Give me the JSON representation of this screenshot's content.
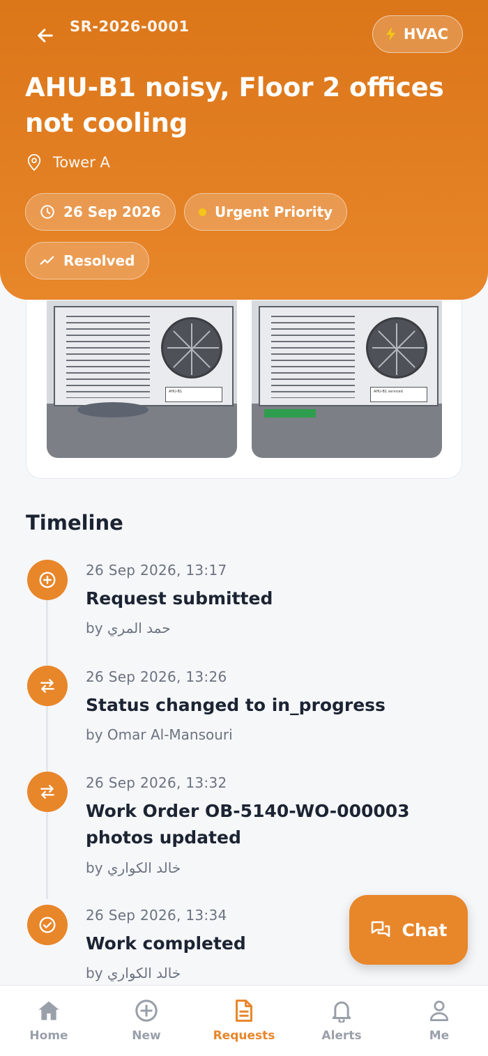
{
  "header": {
    "reference": "SR-2026-0001",
    "category": "HVAC",
    "title": "AHU-B1 noisy, Floor 2 offices not cooling",
    "location": "Tower A",
    "date": "26 Sep 2026",
    "priority": "Urgent Priority",
    "status": "Resolved"
  },
  "photos": {
    "before_label": "AHU-B1",
    "after_label": "AHU-B1 serviced"
  },
  "timeline": {
    "title": "Timeline",
    "events": [
      {
        "time": "26 Sep 2026, 13:17",
        "heading": "Request submitted",
        "by": "by حمد المري",
        "icon": "plus-circle-icon"
      },
      {
        "time": "26 Sep 2026, 13:26",
        "heading": "Status changed to in_progress",
        "by": "by Omar Al-Mansouri",
        "icon": "swap-icon"
      },
      {
        "time": "26 Sep 2026, 13:32",
        "heading": "Work Order OB-5140-WO-000003 photos updated",
        "by": "by خالد الكواري",
        "icon": "swap-icon"
      },
      {
        "time": "26 Sep 2026, 13:34",
        "heading": "Work completed",
        "by": "by خالد الكواري",
        "icon": "check-circle-icon"
      }
    ]
  },
  "chat": {
    "label": "Chat"
  },
  "nav": {
    "items": [
      {
        "label": "Home",
        "icon": "home-icon"
      },
      {
        "label": "New",
        "icon": "plus-circle-icon"
      },
      {
        "label": "Requests",
        "icon": "document-icon",
        "active": true
      },
      {
        "label": "Alerts",
        "icon": "bell-icon"
      },
      {
        "label": "Me",
        "icon": "user-icon"
      }
    ]
  },
  "colors": {
    "accent": "#e8862a",
    "header": "#db7619",
    "priority_dot": "#f5c518"
  }
}
